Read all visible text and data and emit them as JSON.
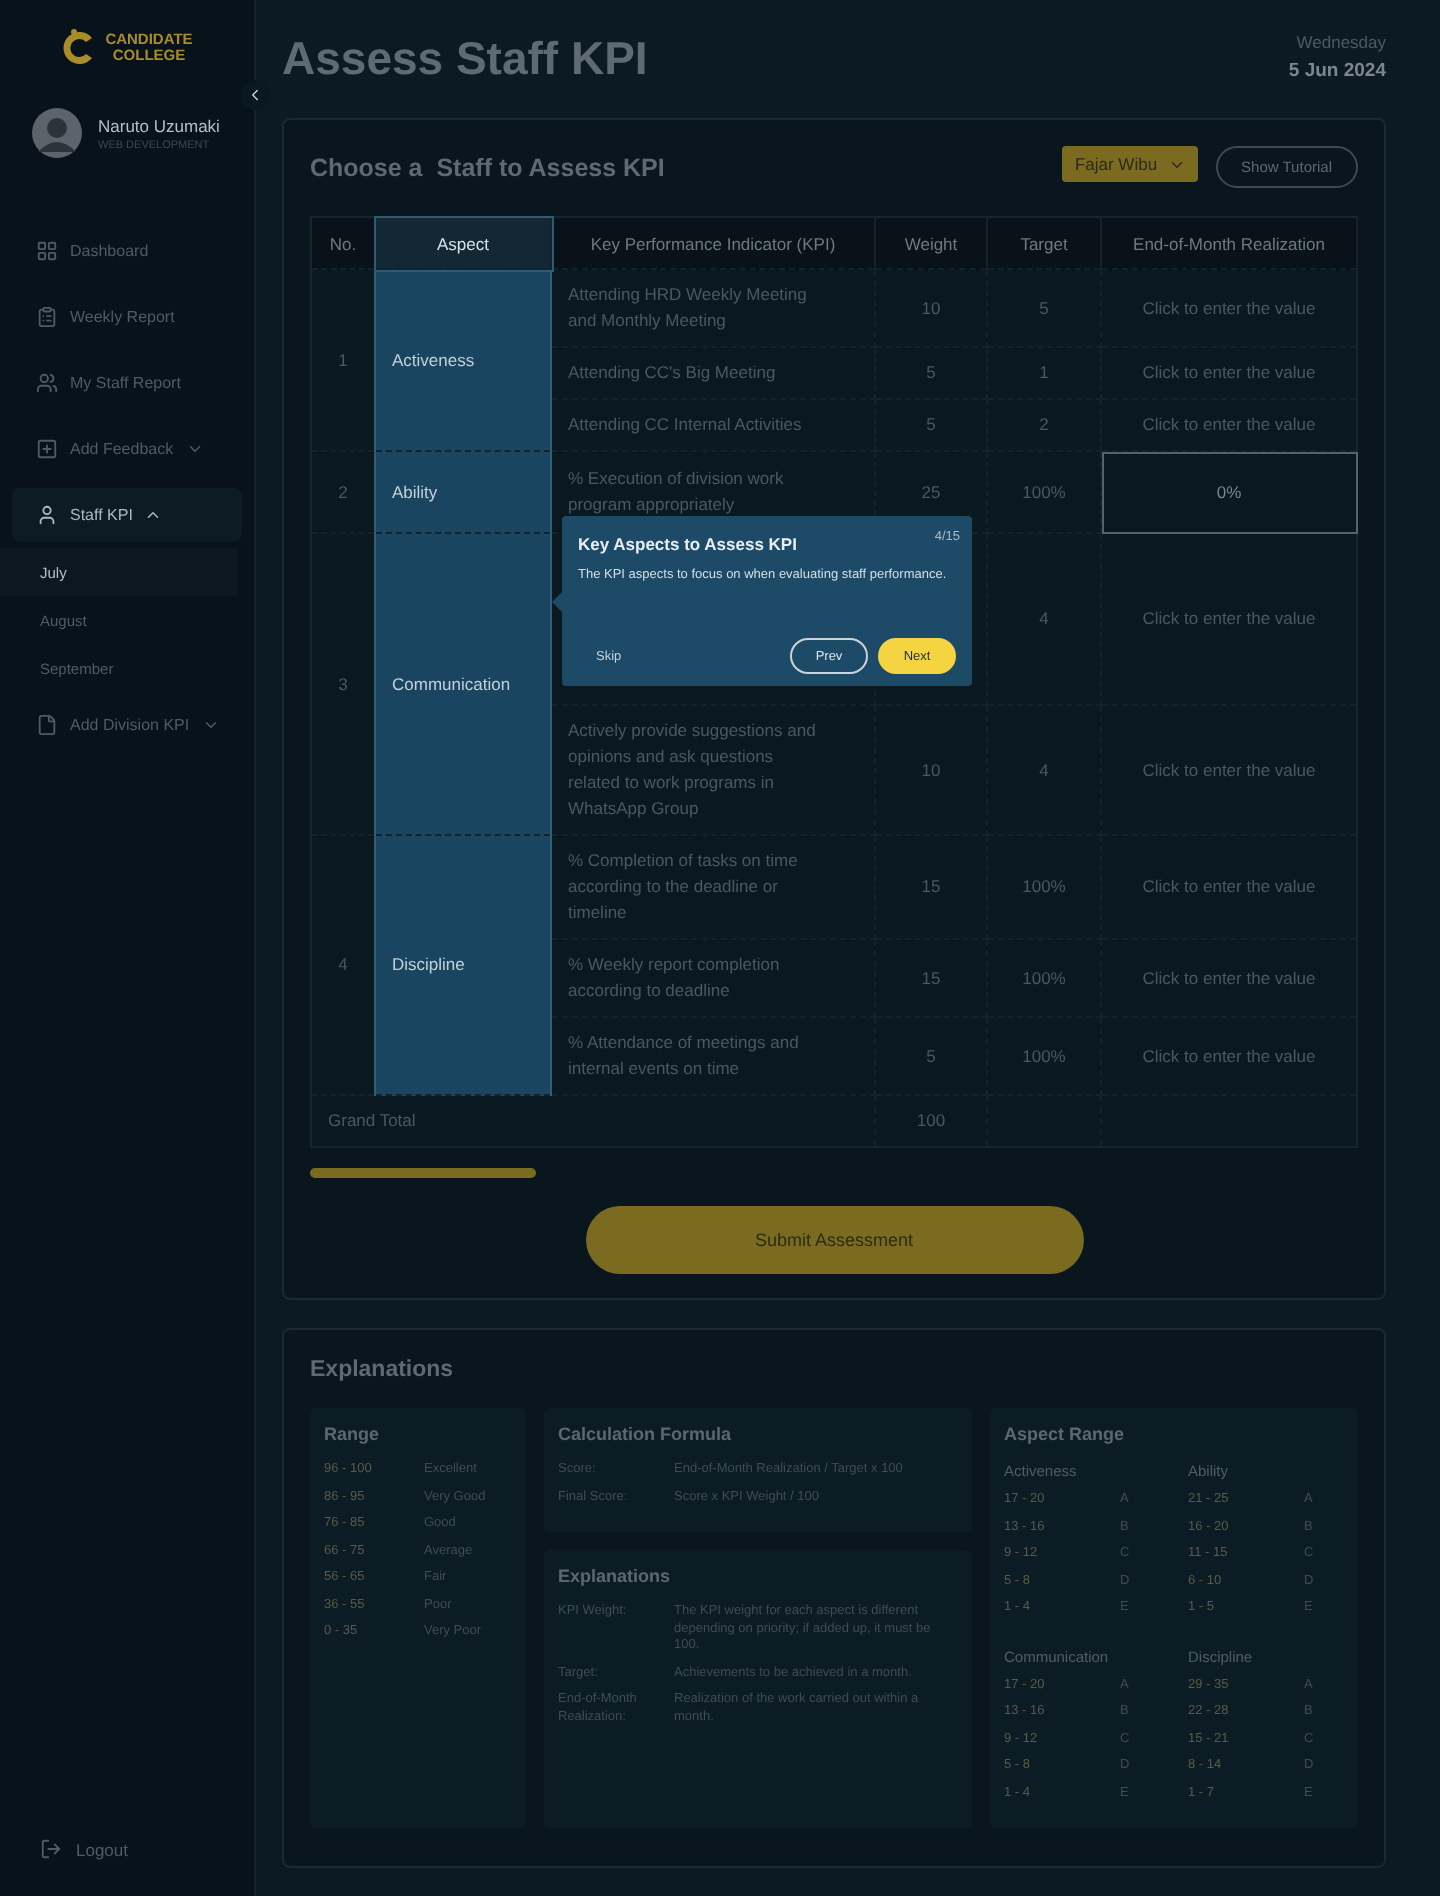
{
  "sidebar": {
    "logo": {
      "line_1": "CANDIDATE",
      "line_2": "COLLEGE"
    },
    "profile": {
      "name": "Naruto Uzumaki",
      "role": "WEB DEVELOPMENT"
    },
    "items": [
      {
        "label": "Dashboard",
        "selected": false
      },
      {
        "label": "Weekly Report",
        "selected": false
      },
      {
        "label": "My Staff Report",
        "selected": false
      },
      {
        "label": "Add Feedback",
        "selected": false,
        "expanded": false
      },
      {
        "label": "Staff KPI",
        "selected": true,
        "expanded": true,
        "children": [
          {
            "label": "July",
            "selected": true
          },
          {
            "label": "August",
            "selected": false
          },
          {
            "label": "September",
            "selected": false
          }
        ]
      },
      {
        "label": "Add Division KPI",
        "selected": false,
        "expanded": false
      }
    ],
    "logout": "Logout"
  },
  "header": {
    "title": "Assess Staff KPI",
    "weekday": "Wednesday",
    "date": "5 Jun 2024"
  },
  "assessment": {
    "title": "Choose a  Staff to Assess KPI",
    "staff_select": "Fajar Wibu",
    "tutorial_button": "Show Tutorial",
    "table": {
      "columns": [
        {
          "label": "No.",
          "spotlight": false
        },
        {
          "label": "Aspect",
          "spotlight": true
        },
        {
          "label": "Key Performance Indicator (KPI)",
          "spotlight": false
        },
        {
          "label": "Weight",
          "spotlight": false
        },
        {
          "label": "Target",
          "spotlight": false
        },
        {
          "label": "End-of-Month Realization",
          "spotlight": false
        }
      ],
      "aspects": [
        {
          "no": "1",
          "name": "Activeness",
          "kpis": [
            {
              "kpi": "Attending HRD Weekly Meeting and Monthly Meeting",
              "weight": "10",
              "target": "5",
              "realization": {
                "placeholder": "Click to enter the value",
                "active": false
              }
            },
            {
              "kpi": "Attending CC's Big Meeting",
              "weight": "5",
              "target": "1",
              "realization": {
                "placeholder": "Click to enter the value",
                "active": false
              }
            },
            {
              "kpi": "Attending CC Internal Activities",
              "weight": "5",
              "target": "2",
              "realization": {
                "placeholder": "Click to enter the value",
                "active": false
              }
            }
          ]
        },
        {
          "no": "2",
          "name": "Ability",
          "kpis": [
            {
              "kpi": "% Execution of division work program appropriately",
              "weight": "25",
              "target": "100%",
              "realization": {
                "value": "0%",
                "active": true
              }
            }
          ]
        },
        {
          "no": "3",
          "name": "Communication",
          "kpis": [
            {
              "target": "4",
              "realization": {
                "placeholder": "Click to enter the value",
                "active": false
              }
            },
            {
              "kpi": "Actively provide suggestions and opinions and ask questions related to work programs in WhatsApp Group",
              "weight": "10",
              "target": "4",
              "realization": {
                "placeholder": "Click to enter the value",
                "active": false
              }
            }
          ]
        },
        {
          "no": "4",
          "name": "Discipline",
          "kpis": [
            {
              "kpi": "% Completion of tasks on time according to the deadline or timeline",
              "weight": "15",
              "target": "100%",
              "realization": {
                "placeholder": "Click to enter the value",
                "active": false
              }
            },
            {
              "kpi": "% Weekly report completion according to deadline",
              "weight": "15",
              "target": "100%",
              "realization": {
                "placeholder": "Click to enter the value",
                "active": false
              }
            },
            {
              "kpi": "% Attendance of meetings and internal events on time",
              "weight": "5",
              "target": "100%",
              "realization": {
                "placeholder": "Click to enter the value",
                "active": false
              }
            }
          ]
        }
      ],
      "total_label": "Grand Total",
      "total_weight": "100"
    },
    "submit_button": "Submit Assessment",
    "tutorial": {
      "title": "Key Aspects to Assess KPI",
      "step": "4/15",
      "text": "The KPI aspects to focus on when evaluating staff performance.",
      "skip": "Skip",
      "prev": "Prev",
      "next": "Next"
    }
  },
  "explanations": {
    "title": "Explanations",
    "range": {
      "title": "Range",
      "rows": [
        {
          "range": "96 - 100",
          "label": "Excellent"
        },
        {
          "range": "86 - 95",
          "label": "Very Good"
        },
        {
          "range": "76 - 85",
          "label": "Good"
        },
        {
          "range": "66 - 75",
          "label": "Average"
        },
        {
          "range": "56 - 65",
          "label": "Fair"
        },
        {
          "range": "36 - 55",
          "label": "Poor"
        },
        {
          "range": "0 - 35",
          "label": "Very Poor"
        }
      ]
    },
    "formula": {
      "title": "Calculation Formula",
      "rows": [
        {
          "term": "Score:",
          "text": "End-of-Month Realization / Target x 100"
        },
        {
          "term": "Final Score:",
          "text": "Score x KPI Weight / 100"
        }
      ]
    },
    "definitions": {
      "title": "Explanations",
      "rows": [
        {
          "term": "KPI Weight:",
          "text": "The KPI weight for each aspect is different depending on priority; if added up, it must be 100."
        },
        {
          "term": "Target:",
          "text": "Achievements to be achieved in a month."
        },
        {
          "term": "End-of-Month Realization:",
          "text": "Realization of the work carried out within a month."
        }
      ]
    },
    "aspect_range": {
      "title": "Aspect Range",
      "groups": [
        {
          "name": "Activeness",
          "rows": [
            {
              "range": "17 - 20",
              "grade": "A"
            },
            {
              "range": "13 - 16",
              "grade": "B"
            },
            {
              "range": "9 - 12",
              "grade": "C"
            },
            {
              "range": "5 - 8",
              "grade": "D"
            },
            {
              "range": "1 - 4",
              "grade": "E"
            }
          ]
        },
        {
          "name": "Ability",
          "rows": [
            {
              "range": "21 - 25",
              "grade": "A"
            },
            {
              "range": "16 - 20",
              "grade": "B"
            },
            {
              "range": "11 - 15",
              "grade": "C"
            },
            {
              "range": "6 - 10",
              "grade": "D"
            },
            {
              "range": "1 - 5",
              "grade": "E"
            }
          ]
        },
        {
          "name": "Communication",
          "rows": [
            {
              "range": "17 - 20",
              "grade": "A"
            },
            {
              "range": "13 - 16",
              "grade": "B"
            },
            {
              "range": "9 - 12",
              "grade": "C"
            },
            {
              "range": "5 - 8",
              "grade": "D"
            },
            {
              "range": "1 - 4",
              "grade": "E"
            }
          ]
        },
        {
          "name": "Discipline",
          "rows": [
            {
              "range": "29 - 35",
              "grade": "A"
            },
            {
              "range": "22 - 28",
              "grade": "B"
            },
            {
              "range": "15 - 21",
              "grade": "C"
            },
            {
              "range": "8 - 14",
              "grade": "D"
            },
            {
              "range": "1 - 7",
              "grade": "E"
            }
          ]
        }
      ]
    }
  }
}
